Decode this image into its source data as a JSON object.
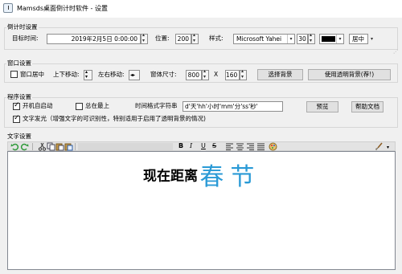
{
  "window": {
    "title": "Mamsds桌面倒计时软件 - 设置"
  },
  "countdown": {
    "group_title": "倒计时设置",
    "target_label": "目标时间:",
    "target_value": "2019年2月5日 0:00:00",
    "position_label": "位置:",
    "position_value": "200",
    "style_label": "样式:",
    "font_value": "Microsoft Yahei",
    "font_size_value": "30",
    "color_value": "#000000",
    "align_value": "居中"
  },
  "window_settings": {
    "group_title": "窗口设置",
    "center_label": "窗口居中",
    "updown_label": "上下移动:",
    "leftright_label": "左右移动:",
    "size_label": "窗体尺寸:",
    "width_value": "800",
    "times_label": "X",
    "height_value": "160",
    "choose_bg_label": "选择背景",
    "transparent_bg_label": "使用透明背景(荐!)"
  },
  "program": {
    "group_title": "程序设置",
    "autostart_label": "开机自启动",
    "autostart_checked": true,
    "ontop_label": "总在最上",
    "ontop_checked": false,
    "format_label": "时间格式字符串",
    "format_value": "d'天'hh'小时'mm'分'ss'秒'",
    "preview_label": "预览",
    "help_label": "帮助文档",
    "glow_label": "文字发光（增强文字的可识别性，特别适用于启用了透明背景的情况)",
    "glow_checked": true
  },
  "text_settings": {
    "group_title": "文字设置",
    "editor_prefix": "现在距离",
    "editor_highlight": "春节",
    "highlight_color": "#2a9ad6",
    "toolbar_icons": [
      "undo-icon",
      "redo-icon",
      "cut-icon",
      "copy-icon",
      "paste-icon",
      "bold-icon",
      "italic-icon",
      "underline-icon",
      "strikethrough-icon",
      "align-left-icon",
      "align-center-icon",
      "align-right-icon",
      "justify-icon",
      "palette-icon",
      "brush-icon"
    ]
  }
}
